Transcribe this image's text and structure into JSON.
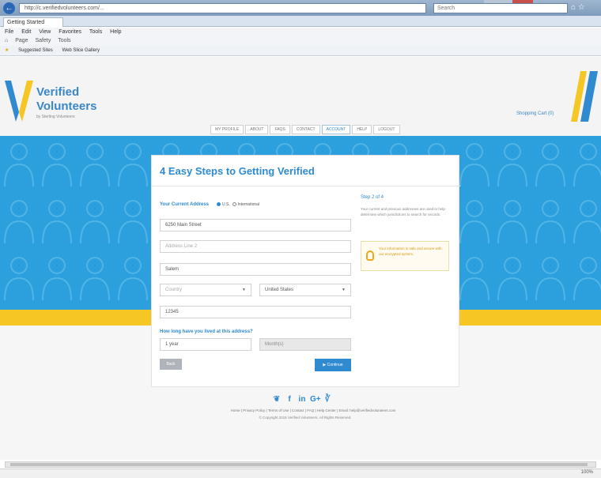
{
  "browser": {
    "address": "http://c.verifiedvolunteers.com/...",
    "search_placeholder": "Search",
    "tab_title": "Getting Started",
    "menu": [
      "File",
      "Edit",
      "View",
      "Favorites",
      "Tools",
      "Help"
    ],
    "toolbar": [
      "Page",
      "Safety",
      "Tools"
    ],
    "favorites": [
      "Suggested Sites",
      "Web Slice Gallery"
    ],
    "zoom": "100%"
  },
  "site": {
    "logo_line1": "Verified",
    "logo_line2": "Volunteers",
    "logo_tag": "by Sterling Volunteers",
    "header_link": "Shopping Cart (0)",
    "nav": [
      "MY PROFILE",
      "ABOUT",
      "FAQS",
      "CONTACT",
      "ACCOUNT",
      "HELP",
      "LOGOUT"
    ],
    "nav_active_index": 4
  },
  "card": {
    "title": "4 Easy Steps to Getting Verified",
    "section_label": "Your Current Address",
    "radio_us": "U.S.",
    "radio_intl": "International",
    "address1": "6250 Main Street",
    "address2_placeholder": "Address Line 2",
    "city": "Salem",
    "country_placeholder": "Country",
    "state": "United States",
    "zip": "12345",
    "duration_label": "How long have you lived at this address?",
    "years": "1 year",
    "months": "Month(s)",
    "back_label": "Back",
    "continue_label": "Continue",
    "side_title": "Step 2 of 4",
    "side_text": "Your current and previous addresses are used to help determine which jurisdictions to search for records.",
    "side_note": "Your information is safe and secure with our encrypted system."
  },
  "footer": {
    "links": "Home | Privacy Policy | Terms of Use | Contact | FAQ | Help Center | Email: help@verifiedvolunteers.com",
    "copyright": "© Copyright 2015 Verified Volunteers. All Rights Reserved."
  }
}
